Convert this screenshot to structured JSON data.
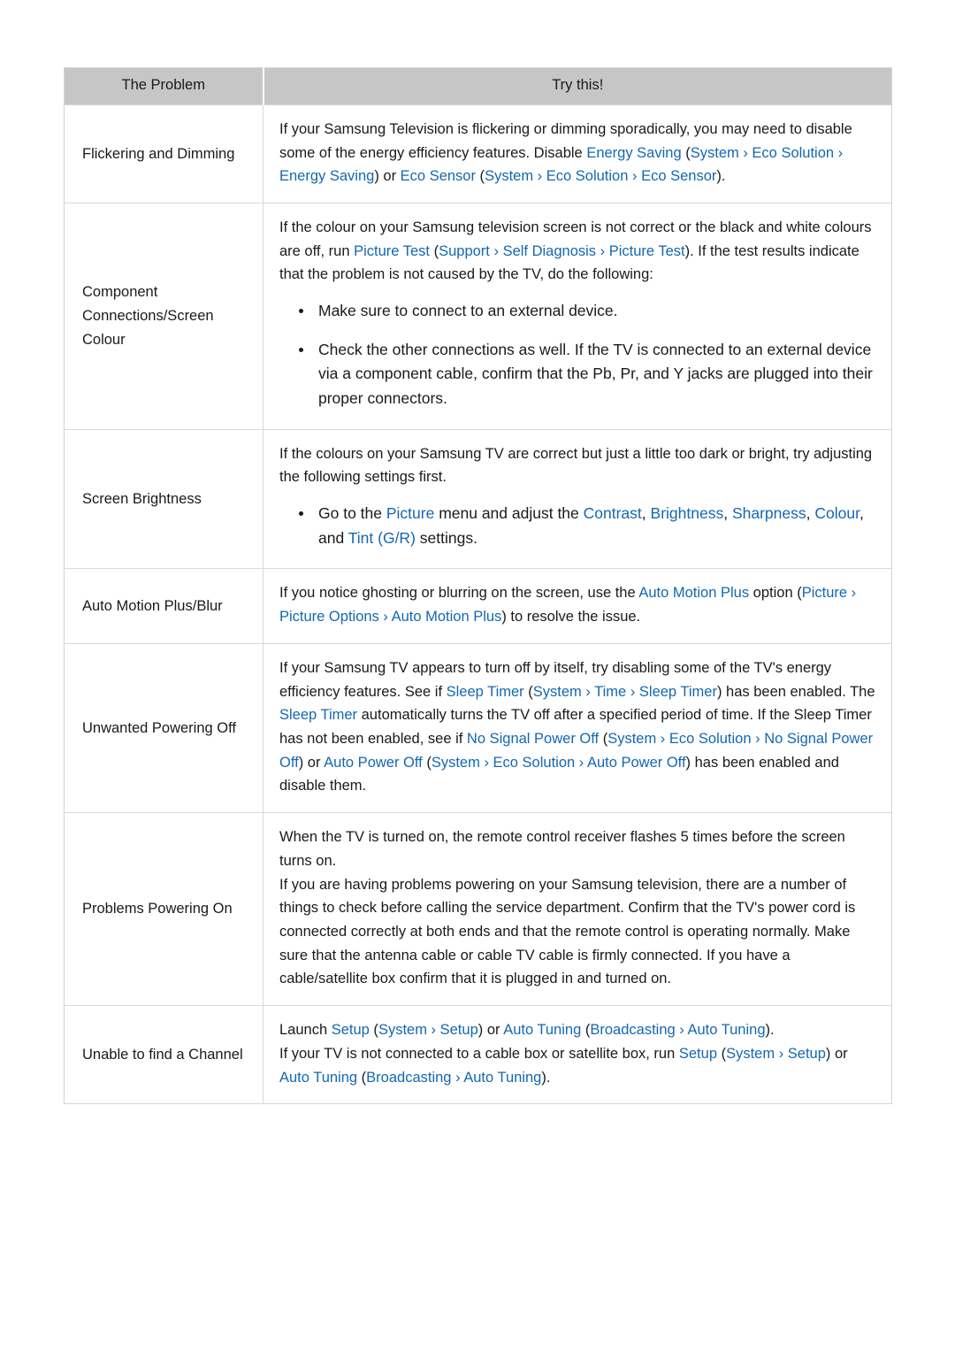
{
  "table": {
    "headers": [
      "The Problem",
      "Try this!"
    ],
    "accent_color": "#1467b3",
    "header_bg": "#c6c6c6",
    "rows": [
      {
        "problem": "Flickering and Dimming",
        "paragraphs": [
          {
            "segments": [
              {
                "t": "If your Samsung Television is flickering or dimming sporadically, you may need to disable some of the energy efficiency features. Disable ",
                "c": "black"
              },
              {
                "t": "Energy Saving",
                "c": "link"
              },
              {
                "t": " (",
                "c": "black"
              },
              {
                "t": "System",
                "c": "link"
              },
              {
                "t": " › ",
                "c": "link"
              },
              {
                "t": "Eco Solution",
                "c": "link"
              },
              {
                "t": " › ",
                "c": "link"
              },
              {
                "t": "Energy Saving",
                "c": "link"
              },
              {
                "t": ")",
                "c": "black"
              },
              {
                "t": " or ",
                "c": "black"
              },
              {
                "t": "Eco Sensor",
                "c": "link"
              },
              {
                "t": " (",
                "c": "black"
              },
              {
                "t": "System",
                "c": "link"
              },
              {
                "t": " › ",
                "c": "link"
              },
              {
                "t": "Eco Solution",
                "c": "link"
              },
              {
                "t": " › ",
                "c": "link"
              },
              {
                "t": "Eco Sensor",
                "c": "link"
              },
              {
                "t": ").",
                "c": "black"
              }
            ]
          }
        ],
        "bullets": []
      },
      {
        "problem": "Component Connections/Screen Colour",
        "paragraphs": [
          {
            "segments": [
              {
                "t": "If the colour on your Samsung television screen is not correct or the black and white colours are off, run ",
                "c": "black"
              },
              {
                "t": "Picture Test",
                "c": "link"
              },
              {
                "t": " (",
                "c": "black"
              },
              {
                "t": "Support",
                "c": "link"
              },
              {
                "t": " › ",
                "c": "link"
              },
              {
                "t": "Self Diagnosis",
                "c": "link"
              },
              {
                "t": " › ",
                "c": "link"
              },
              {
                "t": "Picture Test",
                "c": "link"
              },
              {
                "t": "). If the test results indicate that the problem is not caused by the TV, do the following:",
                "c": "black"
              }
            ]
          }
        ],
        "bullets": [
          {
            "segments": [
              {
                "t": "Make sure to connect to an external device.",
                "c": "black"
              }
            ]
          },
          {
            "segments": [
              {
                "t": "Check the other connections as well. If the TV is connected to an external device via a component cable, confirm that the Pb, Pr, and Y jacks are plugged into their proper connectors.",
                "c": "black"
              }
            ]
          }
        ]
      },
      {
        "problem": "Screen Brightness",
        "paragraphs": [
          {
            "segments": [
              {
                "t": "If the colours on your Samsung TV are correct but just a little too dark or bright, try adjusting the following settings first.",
                "c": "black"
              }
            ]
          }
        ],
        "bullets": [
          {
            "segments": [
              {
                "t": "Go to the ",
                "c": "black"
              },
              {
                "t": "Picture",
                "c": "link"
              },
              {
                "t": " menu and adjust the ",
                "c": "black"
              },
              {
                "t": "Contrast",
                "c": "link"
              },
              {
                "t": ", ",
                "c": "black"
              },
              {
                "t": "Brightness",
                "c": "link"
              },
              {
                "t": ", ",
                "c": "black"
              },
              {
                "t": "Sharpness",
                "c": "link"
              },
              {
                "t": ", ",
                "c": "black"
              },
              {
                "t": "Colour",
                "c": "link"
              },
              {
                "t": ", and ",
                "c": "black"
              },
              {
                "t": "Tint (G/R)",
                "c": "link"
              },
              {
                "t": " settings.",
                "c": "black"
              }
            ]
          }
        ]
      },
      {
        "problem": "Auto Motion Plus/Blur",
        "paragraphs": [
          {
            "segments": [
              {
                "t": "If you notice ghosting or blurring on the screen, use the ",
                "c": "black"
              },
              {
                "t": "Auto Motion Plus",
                "c": "link"
              },
              {
                "t": " option (",
                "c": "black"
              },
              {
                "t": "Picture",
                "c": "link"
              },
              {
                "t": " › ",
                "c": "link"
              },
              {
                "t": "Picture Options",
                "c": "link"
              },
              {
                "t": " › ",
                "c": "link"
              },
              {
                "t": "Auto Motion Plus",
                "c": "link"
              },
              {
                "t": ") to resolve the issue.",
                "c": "black"
              }
            ]
          }
        ],
        "bullets": []
      },
      {
        "problem": "Unwanted Powering Off",
        "paragraphs": [
          {
            "segments": [
              {
                "t": "If your Samsung TV appears to turn off by itself, try disabling some of the TV's energy efficiency features. See if ",
                "c": "black"
              },
              {
                "t": "Sleep Timer",
                "c": "link"
              },
              {
                "t": " (",
                "c": "black"
              },
              {
                "t": "System",
                "c": "link"
              },
              {
                "t": " › ",
                "c": "link"
              },
              {
                "t": "Time",
                "c": "link"
              },
              {
                "t": " › ",
                "c": "link"
              },
              {
                "t": "Sleep Timer",
                "c": "link"
              },
              {
                "t": ") has been enabled. The ",
                "c": "black"
              },
              {
                "t": "Sleep Timer",
                "c": "link"
              },
              {
                "t": " automatically turns the TV off after a specified period of time. If the Sleep Timer has not been enabled, see if ",
                "c": "black"
              },
              {
                "t": "No Signal Power Off",
                "c": "link"
              },
              {
                "t": " (",
                "c": "black"
              },
              {
                "t": "System",
                "c": "link"
              },
              {
                "t": " › ",
                "c": "link"
              },
              {
                "t": "Eco Solution",
                "c": "link"
              },
              {
                "t": " › ",
                "c": "link"
              },
              {
                "t": "No Signal Power Off",
                "c": "link"
              },
              {
                "t": ")",
                "c": "black"
              },
              {
                "t": " or ",
                "c": "black"
              },
              {
                "t": "Auto Power Off",
                "c": "link"
              },
              {
                "t": " (",
                "c": "black"
              },
              {
                "t": "System",
                "c": "link"
              },
              {
                "t": " › ",
                "c": "link"
              },
              {
                "t": "Eco Solution",
                "c": "link"
              },
              {
                "t": " › ",
                "c": "link"
              },
              {
                "t": "Auto Power Off",
                "c": "link"
              },
              {
                "t": ") has been enabled and disable them.",
                "c": "black"
              }
            ]
          }
        ],
        "bullets": []
      },
      {
        "problem": "Problems Powering On",
        "paragraphs": [
          {
            "segments": [
              {
                "t": "When the TV is turned on, the remote control receiver flashes 5 times before the screen turns on.",
                "c": "black"
              }
            ]
          },
          {
            "segments": [
              {
                "t": "If you are having problems powering on your Samsung television, there are a number of things to check before calling the service department. Confirm that the TV's power cord is connected correctly at both ends and that the remote control is operating normally. Make sure that the antenna cable or cable TV cable is firmly connected. If you have a cable/satellite box confirm that it is plugged in and turned on.",
                "c": "black"
              }
            ]
          }
        ],
        "bullets": []
      },
      {
        "problem": "Unable to find a Channel",
        "paragraphs": [
          {
            "segments": [
              {
                "t": "Launch ",
                "c": "black"
              },
              {
                "t": "Setup",
                "c": "link"
              },
              {
                "t": " (",
                "c": "black"
              },
              {
                "t": "System",
                "c": "link"
              },
              {
                "t": " › ",
                "c": "link"
              },
              {
                "t": "Setup",
                "c": "link"
              },
              {
                "t": ")",
                "c": "black"
              },
              {
                "t": " or ",
                "c": "black"
              },
              {
                "t": "Auto Tuning",
                "c": "link"
              },
              {
                "t": " (",
                "c": "black"
              },
              {
                "t": "Broadcasting",
                "c": "link"
              },
              {
                "t": " › ",
                "c": "link"
              },
              {
                "t": "Auto Tuning",
                "c": "link"
              },
              {
                "t": ").",
                "c": "black"
              }
            ]
          },
          {
            "segments": [
              {
                "t": "If your TV is not connected to a cable box or satellite box, run ",
                "c": "black"
              },
              {
                "t": "Setup",
                "c": "link"
              },
              {
                "t": " (",
                "c": "black"
              },
              {
                "t": "System",
                "c": "link"
              },
              {
                "t": " › ",
                "c": "link"
              },
              {
                "t": "Setup",
                "c": "link"
              },
              {
                "t": ")",
                "c": "black"
              },
              {
                "t": " or ",
                "c": "black"
              },
              {
                "t": "Auto Tuning",
                "c": "link"
              },
              {
                "t": " (",
                "c": "black"
              },
              {
                "t": "Broadcasting",
                "c": "link"
              },
              {
                "t": " › ",
                "c": "link"
              },
              {
                "t": "Auto Tuning",
                "c": "link"
              },
              {
                "t": ").",
                "c": "black"
              }
            ]
          }
        ],
        "bullets": []
      }
    ]
  }
}
